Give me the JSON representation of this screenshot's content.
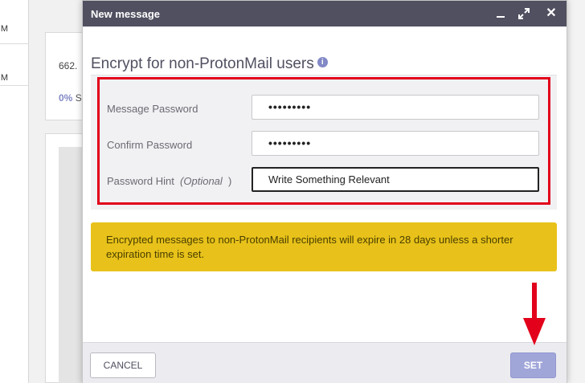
{
  "background": {
    "left_rows": [
      "M",
      "M"
    ],
    "card_number": "662.",
    "card_percent": "0%",
    "card_percent_suffix": "S"
  },
  "dialog": {
    "title": "New message",
    "icons": [
      "minimize-icon",
      "maximize-icon",
      "close-icon"
    ],
    "heading": "Encrypt for non-ProtonMail users",
    "info_icon": "i",
    "fields": {
      "message_password": {
        "label": "Message Password",
        "value": "•••••••••"
      },
      "confirm_password": {
        "label": "Confirm Password",
        "value": "•••••••••"
      },
      "password_hint": {
        "label": "Password Hint",
        "optional": "(Optional",
        "paren_close": ")",
        "value": "Write Something Relevant"
      }
    },
    "notice": "Encrypted messages to non-ProtonMail recipients will expire in 28 days unless a shorter expiration time is set.",
    "buttons": {
      "cancel": "CANCEL",
      "set": "SET"
    }
  },
  "colors": {
    "titlebar": "#505061",
    "highlight": "#e2001a",
    "notice_bg": "#e8c21a",
    "accent": "#8289c6",
    "set_button": "#a1a6d9",
    "arrow": "#e2001a"
  }
}
